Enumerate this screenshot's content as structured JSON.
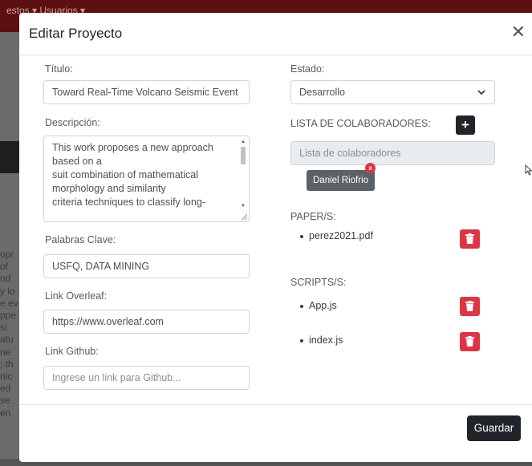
{
  "background": {
    "nav_text": "estos ▾  Usuarios ▾",
    "edge_lines": [
      "opr",
      "of",
      "nd",
      "y lo",
      "e ev",
      "ppe",
      "si",
      "atu",
      "ne",
      "; th",
      "nic",
      "ed",
      "se",
      "en"
    ]
  },
  "modal": {
    "title": "Editar Proyecto",
    "close_glyph": "✕"
  },
  "form": {
    "titulo_label": "Título:",
    "titulo_value": "Toward Real-Time Volcano Seismic Event",
    "descripcion_label": "Descripción:",
    "descripcion_lines": [
      "This work proposes a new approach",
      "based on a",
      "suit combination of mathematical",
      "morphology and similarity",
      "criteria techniques to classify long-"
    ],
    "palabras_label": "Palabras Clave:",
    "palabras_value": "USFQ, DATA MINING",
    "overleaf_label": "Link Overleaf:",
    "overleaf_value": "https://www.overleaf.com",
    "github_label": "Link Github:",
    "github_placeholder": "Ingrese un link para Github...",
    "estado_label": "Estado:",
    "estado_value": "Desarrollo",
    "colaboradores_label": "LISTA DE COLABORADORES:",
    "colaboradores_placeholder": "Lista de colaboradores",
    "colaborador_chip": "Daniel Riofrio",
    "chip_remove_glyph": "x",
    "add_glyph": "+",
    "papers_label": "PAPER/S:",
    "papers": [
      "perez2021.pdf"
    ],
    "scripts_label": "SCRIPTS/S:",
    "scripts": [
      "App.js",
      "index.js"
    ]
  },
  "footer": {
    "save_label": "Guardar"
  },
  "colors": {
    "primary_dark": "#212529",
    "danger": "#dc3545",
    "chip": "#5a6268"
  },
  "icons": {
    "close": "close-icon",
    "add": "plus-icon",
    "trash": "trash-icon",
    "chevron": "chevron-down-icon",
    "cursor": "mouse-cursor-icon"
  }
}
